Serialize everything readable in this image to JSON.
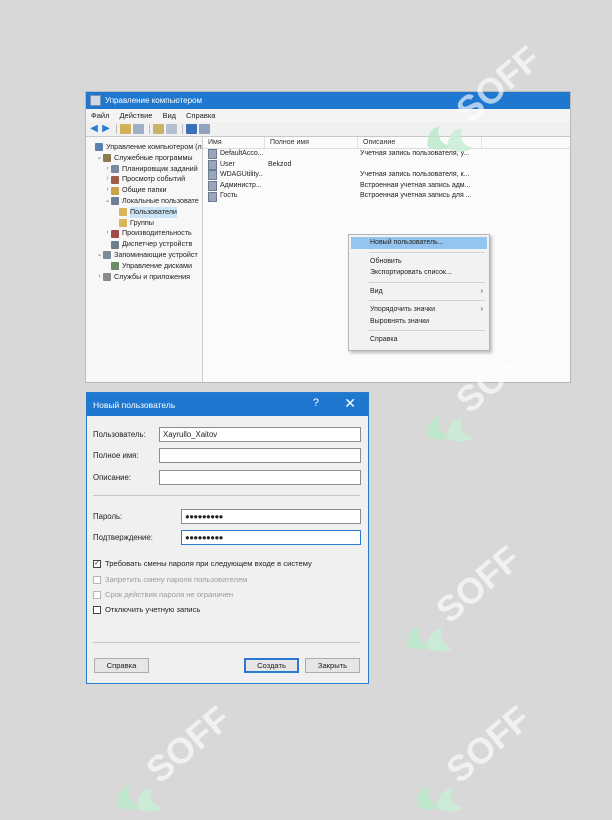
{
  "mmc": {
    "title": "Управление компьютером",
    "menu": [
      "Файл",
      "Действие",
      "Вид",
      "Справка"
    ],
    "tree": [
      {
        "label": "Управление компьютером (л",
        "indent": 0,
        "chev": "",
        "icon": "#5b7fb0"
      },
      {
        "label": "Служебные программы",
        "indent": 1,
        "chev": "⌄",
        "icon": "#8c7a4e"
      },
      {
        "label": "Планировщик заданий",
        "indent": 2,
        "chev": "›",
        "icon": "#7a8aa0"
      },
      {
        "label": "Просмотр событий",
        "indent": 2,
        "chev": "›",
        "icon": "#a05b4b"
      },
      {
        "label": "Общие папки",
        "indent": 2,
        "chev": "›",
        "icon": "#c9a24a"
      },
      {
        "label": "Локальные пользовате",
        "indent": 2,
        "chev": "⌄",
        "icon": "#6f7f95"
      },
      {
        "label": "Пользователи",
        "indent": 3,
        "chev": "",
        "icon": "#d9b55a",
        "selected": true
      },
      {
        "label": "Группы",
        "indent": 3,
        "chev": "",
        "icon": "#d9b55a"
      },
      {
        "label": "Производительность",
        "indent": 2,
        "chev": "›",
        "icon": "#a04a4a"
      },
      {
        "label": "Диспетчер устройств",
        "indent": 2,
        "chev": "",
        "icon": "#6b7c8f"
      },
      {
        "label": "Запоминающие устройст",
        "indent": 1,
        "chev": "⌄",
        "icon": "#7d8a99"
      },
      {
        "label": "Управление дисками",
        "indent": 2,
        "chev": "",
        "icon": "#6b8a6b"
      },
      {
        "label": "Службы и приложения",
        "indent": 1,
        "chev": "›",
        "icon": "#8a8a8a"
      }
    ],
    "columns": [
      "Имя",
      "Полное имя",
      "Описание"
    ],
    "rows": [
      {
        "name": "DefaultAcco...",
        "full": "",
        "desc": "Учетная запись пользователя, у..."
      },
      {
        "name": "User",
        "full": "Bekzod",
        "desc": ""
      },
      {
        "name": "WDAGUtility...",
        "full": "",
        "desc": "Учетная запись пользователя, к..."
      },
      {
        "name": "Администр...",
        "full": "",
        "desc": "Встроенная учетная запись адм..."
      },
      {
        "name": "Гость",
        "full": "",
        "desc": "Встроенная учетная запись для ..."
      }
    ],
    "context_menu": {
      "new_user": "Новый пользователь...",
      "refresh": "Обновить",
      "export": "Экспортировать список...",
      "view": "Вид",
      "arrange": "Упорядочить значки",
      "align": "Выровнять значки",
      "help": "Справка"
    }
  },
  "dialog": {
    "title": "Новый пользователь",
    "help_glyph": "?",
    "close_glyph": "✕",
    "user_label": "Пользователь:",
    "user_value": "Xayrullo_Xaitov",
    "fullname_label": "Полное имя:",
    "fullname_value": "",
    "desc_label": "Описание:",
    "desc_value": "",
    "password_label": "Пароль:",
    "password_value": "●●●●●●●●●",
    "confirm_label": "Подтверждение:",
    "confirm_value": "●●●●●●●●●",
    "chk_change_next": "Требовать смены пароля при следующем входе в систему",
    "chk_change_next_checked": true,
    "chk_forbid_change": "Запретить смену пароля пользователем",
    "chk_never_expires": "Срок действия пароля не ограничен",
    "chk_disable": "Отключить учетную запись",
    "btn_help": "Справка",
    "btn_create": "Создать",
    "btn_close": "Закрыть"
  },
  "watermark": {
    "text": "SOFF",
    "color": "#ffffff"
  }
}
